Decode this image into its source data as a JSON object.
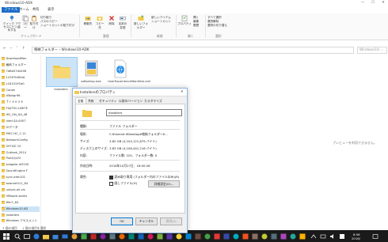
{
  "window": {
    "title": "Windows10-ADK",
    "ctrl_min": "—",
    "ctrl_max": "☐",
    "ctrl_close": "✕"
  },
  "ribbon_tabs": [
    "ファイル",
    "ホーム",
    "共有",
    "表示"
  ],
  "ribbon": {
    "pin": "クイック アクセスにピン留めする",
    "copy": "コピー",
    "paste": "貼り付け",
    "cut": "切り取り",
    "copy_path": "パスのコピー",
    "paste_shortcut": "ショートカットの貼り付け",
    "group_clipboard": "クリップボード",
    "move_to": "移動先",
    "copy_to": "コピー先",
    "delete": "削除",
    "rename": "名前の変更",
    "group_organize": "整理",
    "new_folder": "新しいフォルダー",
    "new_item": "新しいアイテム",
    "easy_access": "ショートカット",
    "group_new": "新規",
    "properties": "プロパティ",
    "open": "開く",
    "edit": "編集",
    "history": "履歴",
    "group_open": "開く",
    "select_all": "すべて選択",
    "select_none": "選択解除",
    "invert": "選択の切り替え",
    "group_select": "選択"
  },
  "address": {
    "path": "格納フォルダー  ›  Windows10-ADK",
    "search_placeholder": "Windows10-..."
  },
  "sidebar": {
    "items": [
      "DownloadMan",
      "格納フォルダー",
      "7d6b07d4406",
      "14767bf0fdd",
      "c1810191b0",
      "Canon",
      "d5bbgr96",
      "ｆｒｅｅｚｅ",
      "FUJITSU LIMITE",
      "HD_Gfx_64_48",
      "Intel-SA-0007",
      "IOデータ",
      "MHC-HC_1.11",
      "NetworkConfig",
      "OFFICE 10",
      "Outlook_2014",
      "PortQryV2",
      "seagate-id3100",
      "SoundEngine F",
      "sync-edrt102",
      "townref411_64",
      "unlock-all-vis",
      "VMware-works",
      "Win7_64",
      "Windows10-AD",
      "Installers",
      "Windows アセスメント"
    ],
    "selected_index": 24
  },
  "files": [
    {
      "name": "Installers",
      "type": "folder"
    },
    {
      "name": "adksetup.exe",
      "type": "exe"
    },
    {
      "name": "UserExperienceManifest.xml",
      "type": "xml"
    }
  ],
  "preview_text": "プレビューを利用できません。",
  "status": {
    "count": "3 個の項目",
    "selected": "1 個の項目を選択"
  },
  "dialog": {
    "title": "Installersのプロパティ",
    "tabs": [
      "全般",
      "共有",
      "セキュリティ",
      "以前のバージョン",
      "カスタマイズ"
    ],
    "name": "Installers",
    "rows": [
      {
        "label": "種類:",
        "value": "ファイル フォルダー"
      },
      {
        "label": "場所:",
        "value": "C:¥Users¥        ¥Desktop¥格納フォルダー¥..."
      },
      {
        "label": "サイズ:",
        "value": "3.82 GB (4,104,121,879 バイト)"
      },
      {
        "label": "ディスク上のサイズ:",
        "value": "3.83 GB (4,108,441,216 バイト)"
      },
      {
        "label": "内容:",
        "value": "ファイル数: 225、フォルダー数: 0"
      },
      {
        "label": "作成日時:",
        "value": "2016年10月27日、18:00:26"
      }
    ],
    "attr_label": "属性:",
    "readonly": "読み取り専用 (フォルダー内のファイルのみ)(R)",
    "hidden": "隠しファイル(H)",
    "advanced": "詳細設定(D)...",
    "ok": "OK",
    "cancel": "キャンセル",
    "apply": "適用(A)"
  },
  "taskbar": {
    "time": "8:56",
    "date": "2016/"
  }
}
